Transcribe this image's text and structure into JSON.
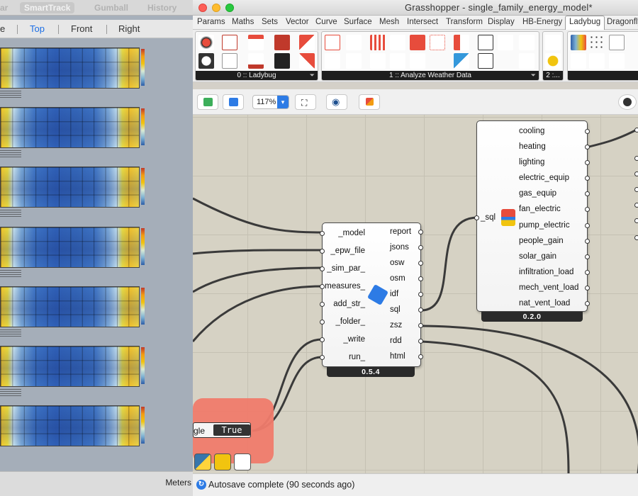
{
  "rhino": {
    "top_tabs": [
      "ar",
      "SmartTrack",
      "Gumball",
      "History"
    ],
    "view_tabs": [
      "e",
      "Top",
      "Front",
      "Right"
    ],
    "active_view": "Top",
    "units": "Meters"
  },
  "window": {
    "title": "Grasshopper - single_family_energy_model*"
  },
  "tabs": [
    "Params",
    "Maths",
    "Sets",
    "Vector",
    "Curve",
    "Surface",
    "Mesh",
    "Intersect",
    "Transform",
    "Display",
    "HB-Energy",
    "Ladybug",
    "Dragonfly"
  ],
  "active_tab": "Ladybug",
  "ribbon": {
    "panels": [
      {
        "label": "0 :: Ladybug"
      },
      {
        "label": "1 :: Analyze Weather Data"
      },
      {
        "label": "2 :..."
      }
    ]
  },
  "canvas_toolbar": {
    "zoom": "117%"
  },
  "components": {
    "run_sim": {
      "inputs": [
        "_model",
        "_epw_file",
        "_sim_par_",
        "measures_",
        "add_str_",
        "_folder_",
        "_write",
        "run_"
      ],
      "outputs": [
        "report",
        "jsons",
        "osw",
        "osm",
        "idf",
        "sql",
        "zsz",
        "rdd",
        "html"
      ],
      "version": "0.5.4"
    },
    "read_results": {
      "inputs": [
        "_sql"
      ],
      "outputs": [
        "cooling",
        "heating",
        "lighting",
        "electric_equip",
        "gas_equip",
        "fan_electric",
        "pump_electric",
        "people_gain",
        "solar_gain",
        "infiltration_load",
        "mech_vent_load",
        "nat_vent_load"
      ],
      "version": "0.2.0"
    },
    "toggle": {
      "label": "gle",
      "value": "True"
    }
  },
  "status": {
    "text": "Autosave complete (90 seconds ago)"
  },
  "colors": {
    "group_fill": "#f07b6c",
    "canvas": "#d6d2c4",
    "accent_blue": "#2d7be5"
  }
}
